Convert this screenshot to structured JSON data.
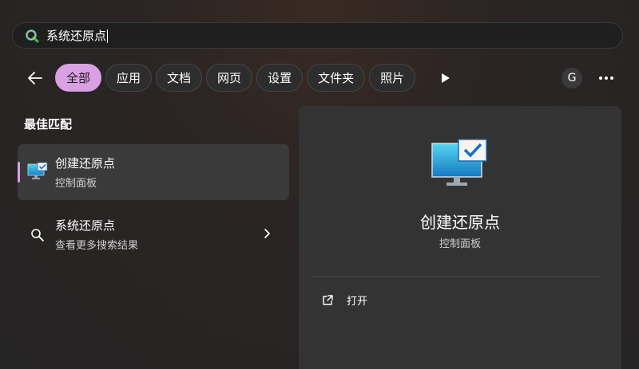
{
  "search": {
    "query": "系统还原点"
  },
  "filters": [
    {
      "label": "全部",
      "active": true
    },
    {
      "label": "应用",
      "active": false
    },
    {
      "label": "文档",
      "active": false
    },
    {
      "label": "网页",
      "active": false
    },
    {
      "label": "设置",
      "active": false
    },
    {
      "label": "文件夹",
      "active": false
    },
    {
      "label": "照片",
      "active": false
    }
  ],
  "account": {
    "initial": "G"
  },
  "best_match": {
    "section_title": "最佳匹配",
    "title": "创建还原点",
    "subtitle": "控制面板"
  },
  "web_result": {
    "title": "系统还原点",
    "subtitle": "查看更多搜索结果"
  },
  "preview": {
    "title": "创建还原点",
    "subtitle": "控制面板",
    "actions": [
      {
        "label": "打开",
        "icon": "open-external-icon"
      }
    ]
  },
  "colors": {
    "accent": "#d9a0e3",
    "panel": "#333333",
    "search_bg": "#1f1f1f"
  }
}
